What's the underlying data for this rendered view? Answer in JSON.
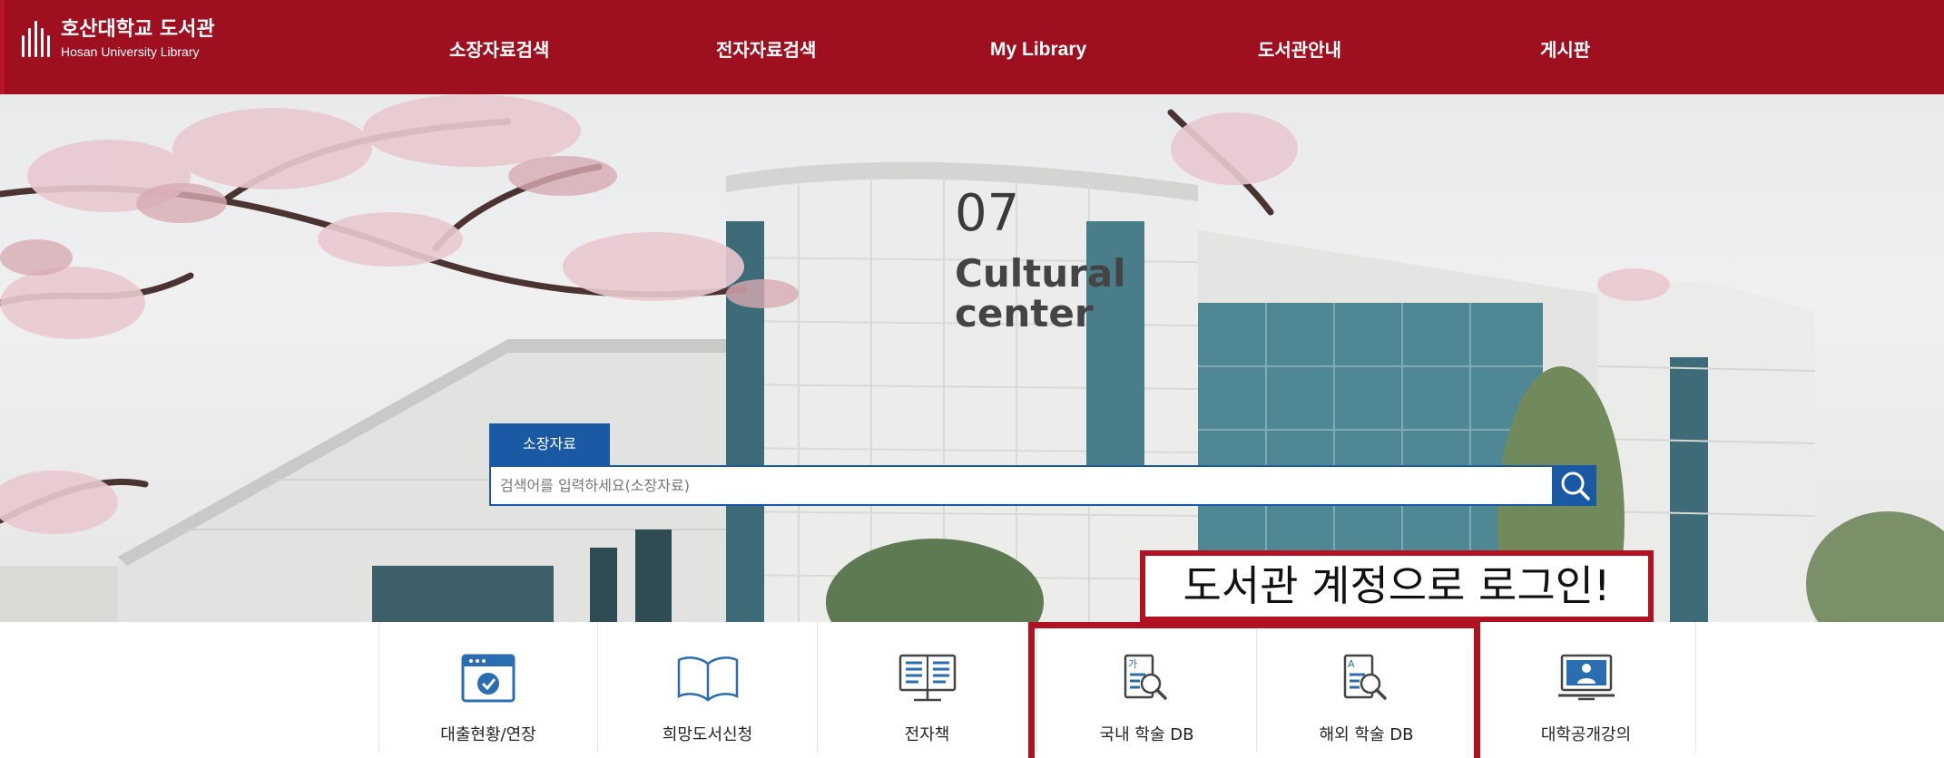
{
  "header": {
    "logo": {
      "title_ko": "호산대학교 도서관",
      "title_en": "Hosan University Library"
    },
    "nav": [
      {
        "label": "소장자료검색"
      },
      {
        "label": "전자자료검색"
      },
      {
        "label": "My Library"
      },
      {
        "label": "도서관안내"
      },
      {
        "label": "게시판"
      }
    ]
  },
  "hero": {
    "building_number": "07",
    "building_sign_line1": "Cultural",
    "building_sign_line2": "center"
  },
  "search": {
    "tab_label": "소장자료",
    "placeholder": "검색어를 입력하세요(소장자료)",
    "button_icon": "search-icon"
  },
  "annotation": {
    "text": "도서관 계정으로 로그인!"
  },
  "quick_menu": [
    {
      "label": "대출현황/연장",
      "icon": "calendar-check-icon"
    },
    {
      "label": "희망도서신청",
      "icon": "open-book-icon"
    },
    {
      "label": "전자책",
      "icon": "ebook-icon"
    },
    {
      "label": "국내 학술 DB",
      "icon": "domestic-db-search-icon"
    },
    {
      "label": "해외 학술 DB",
      "icon": "foreign-db-search-icon"
    },
    {
      "label": "대학공개강의",
      "icon": "lecture-monitor-icon"
    }
  ],
  "colors": {
    "brand": "#9e1020",
    "search_blue": "#1a5aa5",
    "annotation_red": "#b11222",
    "icon_blue": "#2a6db0"
  }
}
